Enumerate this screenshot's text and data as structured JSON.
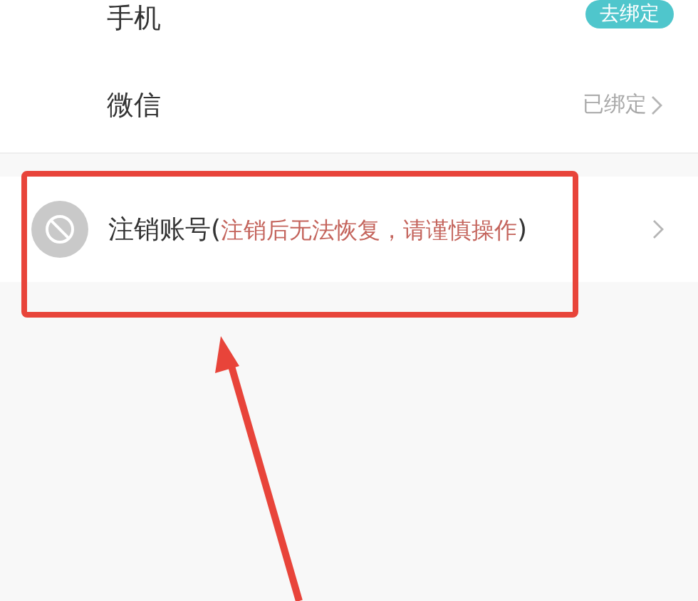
{
  "rows": [
    {
      "kind": "badge-row",
      "label": "手机",
      "action": "去绑定"
    },
    {
      "kind": "status-row",
      "label": "微信",
      "status": "已绑定"
    },
    {
      "kind": "danger-row",
      "label": "注销账号(",
      "note": "注销后无法恢复，请谨慎操作",
      "label_end": ")"
    }
  ]
}
